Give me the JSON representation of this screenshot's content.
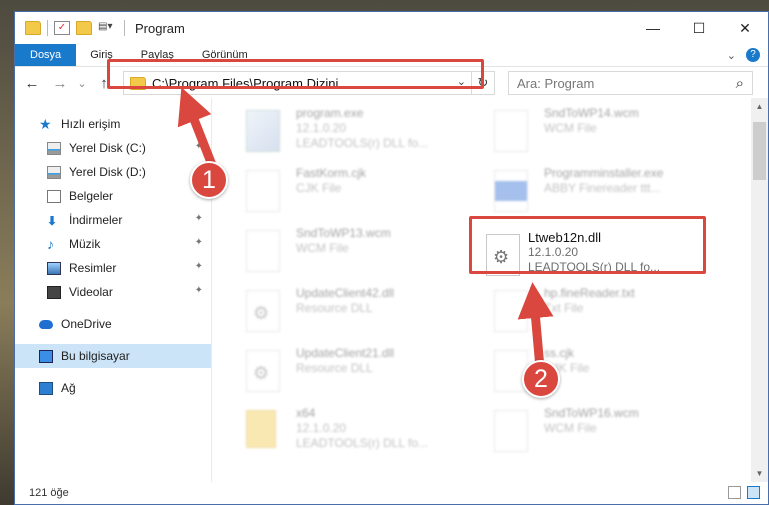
{
  "window": {
    "title": "Program",
    "controls": {
      "minimize": "—",
      "maximize": "☐",
      "close": "✕"
    }
  },
  "ribbon": {
    "tabs": [
      "Dosya",
      "Giriş",
      "Paylaş",
      "Görünüm"
    ],
    "active_tab": "Dosya",
    "expand_icon": "⌄",
    "help_icon": "?"
  },
  "navigation": {
    "back": "←",
    "forward": "→",
    "recent": "⌄",
    "up": "↑",
    "address": "C:\\Program Files\\Program Dizini",
    "dropdown": "⌄",
    "refresh": "↻",
    "search_placeholder": "Ara: Program",
    "search_icon": "⌕"
  },
  "sidebar": {
    "items": [
      {
        "label": "Hızlı erişim",
        "icon": "star-icon",
        "pinned": false
      },
      {
        "label": "Yerel Disk (C:)",
        "icon": "disk-icon",
        "pinned": true
      },
      {
        "label": "Yerel Disk (D:)",
        "icon": "disk-icon",
        "pinned": true
      },
      {
        "label": "Belgeler",
        "icon": "document-icon",
        "pinned": true
      },
      {
        "label": "İndirmeler",
        "icon": "download-icon",
        "pinned": true
      },
      {
        "label": "Müzik",
        "icon": "music-icon",
        "pinned": true
      },
      {
        "label": "Resimler",
        "icon": "pictures-icon",
        "pinned": true
      },
      {
        "label": "Videolar",
        "icon": "video-icon",
        "pinned": true
      },
      {
        "label": "OneDrive",
        "icon": "cloud-icon",
        "pinned": false
      },
      {
        "label": "Bu bilgisayar",
        "icon": "computer-icon",
        "pinned": false,
        "selected": true
      },
      {
        "label": "Ağ",
        "icon": "network-icon",
        "pinned": false
      }
    ],
    "pin_glyph": "📌"
  },
  "files": [
    {
      "name": "program.exe",
      "line1": "12.1.0.20",
      "line2": "LEADTOOLS(r) DLL fo...",
      "kind": "exe"
    },
    {
      "name": "SndToWP14.wcm",
      "line1": "WCM File",
      "line2": "",
      "kind": "doc"
    },
    {
      "name": "FastKorm.cjk",
      "line1": "CJK File",
      "line2": "",
      "kind": "doc"
    },
    {
      "name": "Programminstaller.exe",
      "line1": "ABBY Finereader ttt...",
      "line2": "",
      "kind": "blue"
    },
    {
      "name": "SndToWP13.wcm",
      "line1": "WCM File",
      "line2": "",
      "kind": "doc"
    },
    {
      "name": "Ltweb12n.dll",
      "line1": "12.1.0.20",
      "line2": "LEADTOOLS(r) DLL fo...",
      "kind": "dll",
      "highlighted": true
    },
    {
      "name": "UpdateClient42.dll",
      "line1": "Resource DLL",
      "line2": "",
      "kind": "dll"
    },
    {
      "name": "hp.fineReader.txt",
      "line1": "Txt File",
      "line2": "",
      "kind": "doc"
    },
    {
      "name": "UpdateClient21.dll",
      "line1": "Resource DLL",
      "line2": "",
      "kind": "dll"
    },
    {
      "name": "ss.cjk",
      "line1": "CJK File",
      "line2": "",
      "kind": "doc"
    },
    {
      "name": "x64",
      "line1": "12.1.0.20",
      "line2": "LEADTOOLS(r) DLL fo...",
      "kind": "folder"
    },
    {
      "name": "SndToWP16.wcm",
      "line1": "WCM File",
      "line2": "",
      "kind": "doc"
    }
  ],
  "annotations": {
    "badge1": "1",
    "badge2": "2",
    "color": "#d9473f"
  },
  "status": {
    "count": "121 öğe"
  },
  "colors": {
    "accent": "#1979ca",
    "highlight": "#d9473f",
    "selection": "#cce4f7"
  }
}
